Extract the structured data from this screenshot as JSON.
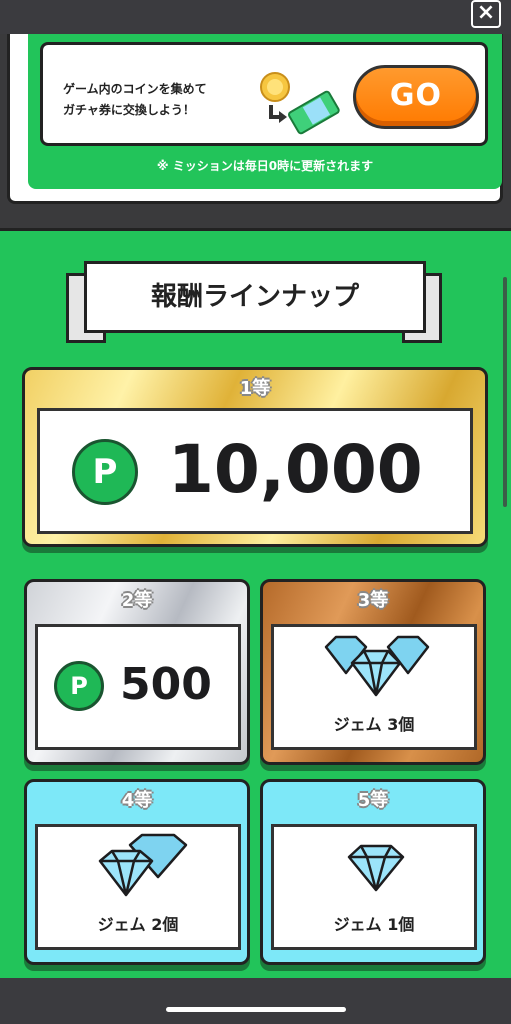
{
  "window": {
    "close_icon": "close-icon"
  },
  "mission": {
    "text_line1": "ゲーム内のコインを集めて",
    "text_line2": "ガチャ券に交換しよう！",
    "go_label": "GO",
    "note": "※ ミッションは毎日0時に更新されます"
  },
  "rewards": {
    "title": "報酬ラインナップ",
    "prizes": [
      {
        "rank": "1等",
        "amount": "10,000",
        "icon": "p-point-icon"
      },
      {
        "rank": "2等",
        "amount": "500",
        "icon": "p-point-icon"
      },
      {
        "rank": "3等",
        "label": "ジェム 3個",
        "icon": "gem-icon"
      },
      {
        "rank": "4等",
        "label": "ジェム 2個",
        "icon": "gem-icon"
      },
      {
        "rank": "5等",
        "label": "ジェム 1個",
        "icon": "gem-icon"
      }
    ],
    "p_letter": "P"
  },
  "colors": {
    "green": "#22c45a",
    "orange": "#ff7a00",
    "gold": "#e0b238",
    "silver": "#c4c7cc",
    "bronze": "#b56a2a",
    "cyan": "#7de8f8"
  }
}
